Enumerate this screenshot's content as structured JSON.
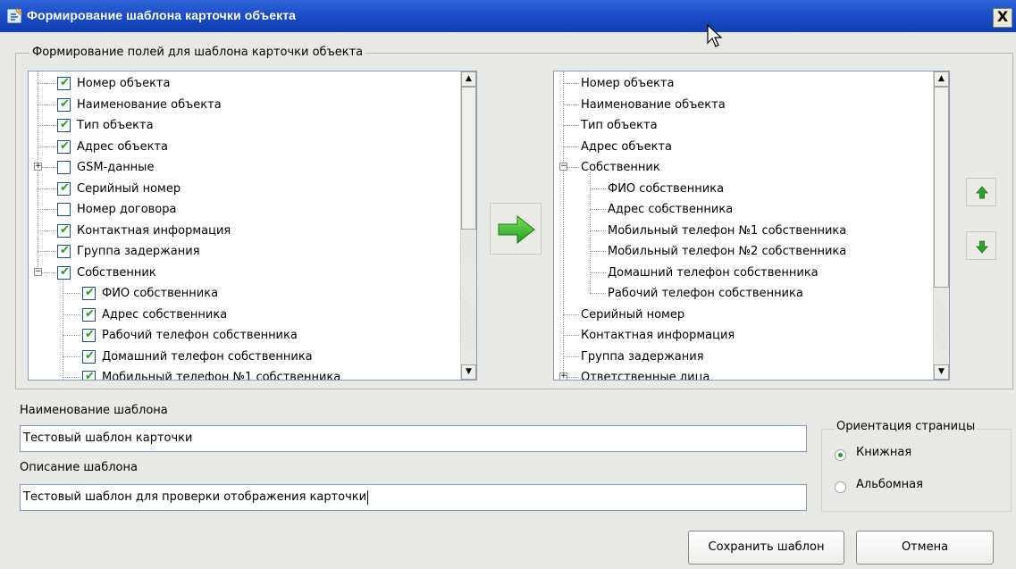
{
  "window": {
    "title": "Формирование шаблона карточки объекта",
    "close_glyph": "X"
  },
  "group": {
    "title": "Формирование полей для шаблона карточки объекта"
  },
  "left_tree": [
    {
      "label": "Номер объекта",
      "checked": true
    },
    {
      "label": "Наименование объекта",
      "checked": true
    },
    {
      "label": "Тип объекта",
      "checked": true
    },
    {
      "label": "Адрес объекта",
      "checked": true
    },
    {
      "label": "GSM-данные",
      "checked": false
    },
    {
      "label": "Серийный номер",
      "checked": true
    },
    {
      "label": "Номер договора",
      "checked": false
    },
    {
      "label": "Контактная информация",
      "checked": true
    },
    {
      "label": "Группа задержания",
      "checked": true
    },
    {
      "label": "Собственник",
      "checked": true
    },
    {
      "label": "ФИО собственника",
      "checked": true
    },
    {
      "label": "Адрес собственника",
      "checked": true
    },
    {
      "label": "Рабочий телефон собственника",
      "checked": true
    },
    {
      "label": "Домашний телефон собственника",
      "checked": true
    },
    {
      "label": "Мобильный телефон №1 собственника",
      "checked": true
    }
  ],
  "right_tree": [
    {
      "label": "Номер объекта"
    },
    {
      "label": "Наименование объекта"
    },
    {
      "label": "Тип объекта"
    },
    {
      "label": "Адрес объекта"
    },
    {
      "label": "Собственник"
    },
    {
      "label": "ФИО собственника"
    },
    {
      "label": "Адрес собственника"
    },
    {
      "label": "Мобильный телефон №1 собственника"
    },
    {
      "label": "Мобильный телефон №2 собственника"
    },
    {
      "label": "Домашний телефон собственника"
    },
    {
      "label": "Рабочий телефон собственника"
    },
    {
      "label": "Серийный номер"
    },
    {
      "label": "Контактная информация"
    },
    {
      "label": "Группа задержания"
    },
    {
      "label": "Ответственные лица"
    }
  ],
  "form": {
    "name_label": "Наименование шаблона",
    "name_value": "Тестовый шаблон карточки",
    "desc_label": "Описание шаблона",
    "desc_value": "Тестовый шаблон для проверки отображения карточки"
  },
  "orientation": {
    "title": "Ориентация страницы",
    "options": [
      {
        "label": "Книжная",
        "selected": true
      },
      {
        "label": "Альбомная",
        "selected": false
      }
    ]
  },
  "buttons": {
    "save": "Сохранить шаблон",
    "cancel": "Отмена"
  },
  "icons": {
    "transfer": "arrow-right-icon",
    "move_up": "arrow-up-icon",
    "move_down": "arrow-down-icon"
  },
  "colors": {
    "titlebar": "#1a4cc6",
    "accent_green": "#21a121"
  }
}
